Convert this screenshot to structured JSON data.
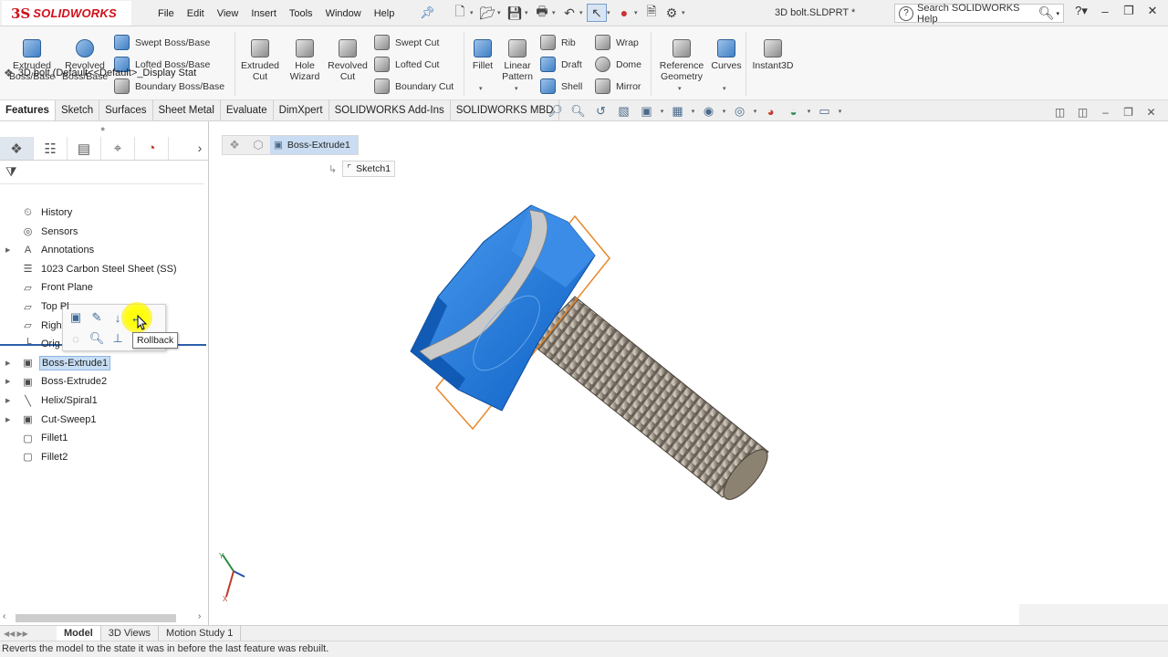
{
  "app": {
    "brand": "SOLIDWORKS",
    "brand_prefix": "3S",
    "doc_title": "3D bolt.SLDPRT *"
  },
  "menu": [
    "File",
    "Edit",
    "View",
    "Insert",
    "Tools",
    "Window",
    "Help"
  ],
  "search": {
    "placeholder": "Search SOLIDWORKS Help"
  },
  "commands": {
    "extruded_boss": "Extruded\nBoss/Base",
    "revolved_boss": "Revolved\nBoss/Base",
    "swept_boss": "Swept Boss/Base",
    "lofted_boss": "Lofted Boss/Base",
    "boundary_boss": "Boundary Boss/Base",
    "extruded_cut": "Extruded\nCut",
    "hole_wizard": "Hole\nWizard",
    "revolved_cut": "Revolved\nCut",
    "swept_cut": "Swept Cut",
    "lofted_cut": "Lofted Cut",
    "boundary_cut": "Boundary Cut",
    "fillet": "Fillet",
    "linear_pattern": "Linear\nPattern",
    "rib": "Rib",
    "draft": "Draft",
    "shell": "Shell",
    "wrap": "Wrap",
    "dome": "Dome",
    "mirror": "Mirror",
    "reference_geometry": "Reference\nGeometry",
    "curves": "Curves",
    "instant3d": "Instant3D"
  },
  "tabs": [
    "Features",
    "Sketch",
    "Surfaces",
    "Sheet Metal",
    "Evaluate",
    "DimXpert",
    "SOLIDWORKS Add-Ins",
    "SOLIDWORKS MBD"
  ],
  "active_tab": "Features",
  "tree": {
    "root": "3D bolt  (Default<<Default>_Display Stat",
    "items": [
      {
        "label": "History",
        "icon": "history-icon",
        "expandable": false
      },
      {
        "label": "Sensors",
        "icon": "sensors-icon",
        "expandable": false
      },
      {
        "label": "Annotations",
        "icon": "annotations-icon",
        "expandable": true
      },
      {
        "label": "1023 Carbon Steel Sheet (SS)",
        "icon": "material-icon",
        "expandable": false
      },
      {
        "label": "Front Plane",
        "icon": "plane-icon",
        "expandable": false
      },
      {
        "label": "Top Pl",
        "icon": "plane-icon",
        "expandable": false
      },
      {
        "label": "Righ",
        "icon": "plane-icon",
        "expandable": false
      },
      {
        "label": "Orig",
        "icon": "origin-icon",
        "expandable": false
      },
      {
        "label": "Boss-Extrude1",
        "icon": "extrude-icon",
        "expandable": true,
        "selected": true
      },
      {
        "label": "Boss-Extrude2",
        "icon": "extrude-icon",
        "expandable": true
      },
      {
        "label": "Helix/Spiral1",
        "icon": "helix-icon",
        "expandable": true
      },
      {
        "label": "Cut-Sweep1",
        "icon": "sweep-icon",
        "expandable": true
      },
      {
        "label": "Fillet1",
        "icon": "fillet-icon",
        "expandable": false
      },
      {
        "label": "Fillet2",
        "icon": "fillet-icon",
        "expandable": false
      }
    ]
  },
  "tooltip": "Rollback",
  "breadcrumb": {
    "current": "Boss-Extrude1",
    "child": "Sketch1"
  },
  "bottom_tabs": [
    "Model",
    "3D Views",
    "Motion Study 1"
  ],
  "active_bottom_tab": "Model",
  "status": "Reverts the model to the state it was in before the last feature was rebuilt.",
  "colors": {
    "accent": "#2a5faa",
    "selection": "#c8def5",
    "brand": "#d0101a",
    "head_blue": "#1e6fd6",
    "highlight_orange": "#e8872a"
  }
}
